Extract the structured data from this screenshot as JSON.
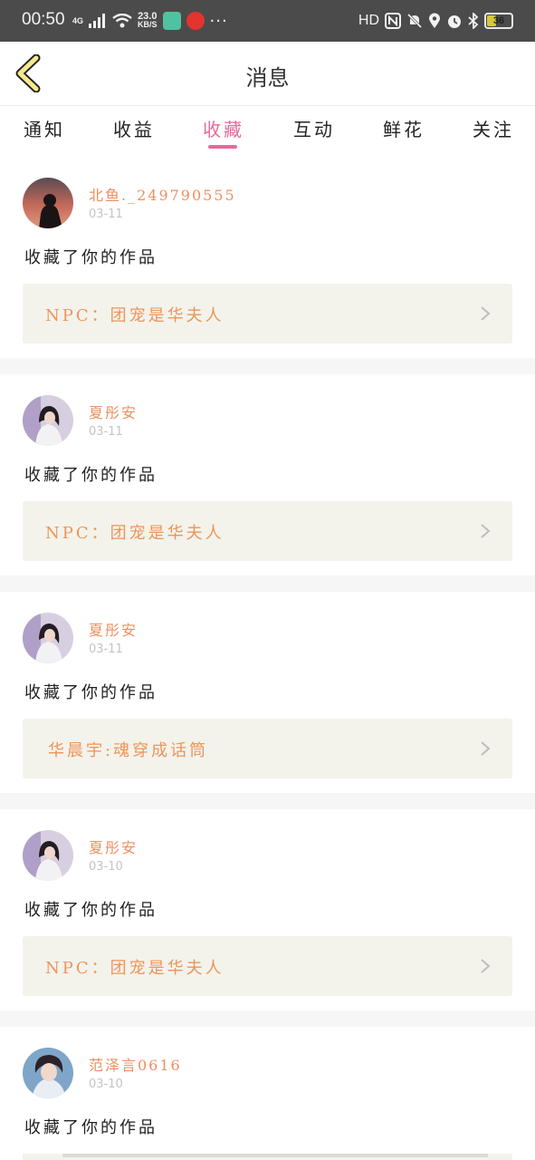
{
  "status_bar": {
    "time": "00:50",
    "net_type": "4G",
    "speed_value": "23.0",
    "speed_unit": "KB/S",
    "hd": "HD",
    "more": "···",
    "battery": "36"
  },
  "header": {
    "title": "消息"
  },
  "tabs": [
    {
      "label": "通知"
    },
    {
      "label": "收益"
    },
    {
      "label": "收藏"
    },
    {
      "label": "互动"
    },
    {
      "label": "鲜花"
    },
    {
      "label": "关注"
    }
  ],
  "active_tab": "收藏",
  "items": [
    {
      "user": "北鱼._249790555",
      "date": "03-11",
      "action": "收藏了你的作品",
      "work": "NPC：团宠是华夫人"
    },
    {
      "user": "夏彤安",
      "date": "03-11",
      "action": "收藏了你的作品",
      "work": "NPC：团宠是华夫人"
    },
    {
      "user": "夏彤安",
      "date": "03-11",
      "action": "收藏了你的作品",
      "work": "华晨宇:魂穿成话筒"
    },
    {
      "user": "夏彤安",
      "date": "03-10",
      "action": "收藏了你的作品",
      "work": "NPC：团宠是华夫人"
    },
    {
      "user": "范泽言0616",
      "date": "03-10",
      "action": "收藏了你的作品",
      "work": ""
    }
  ],
  "colors": {
    "accent": "#e56a9c",
    "username": "#ee8f5f",
    "work_title": "#ef9458",
    "work_bg": "#f3f3ec",
    "status_bar": "#4b4b4b"
  }
}
